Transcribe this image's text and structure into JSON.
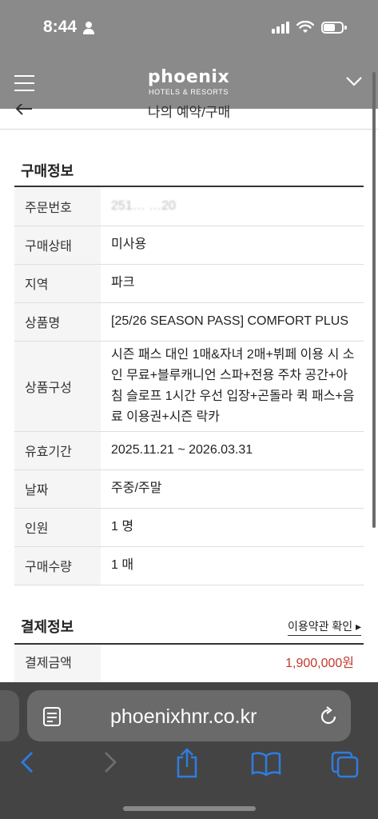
{
  "status_bar": {
    "time": "8:44"
  },
  "header": {
    "brand_logo": "phoenix",
    "brand_sub": "HOTELS & RESORTS"
  },
  "page": {
    "title": "나의 예약/구매"
  },
  "purchase": {
    "section_title": "구매정보",
    "rows": [
      {
        "key": "주문번호",
        "value": "251… …20"
      },
      {
        "key": "구매상태",
        "value": "미사용"
      },
      {
        "key": "지역",
        "value": "파크"
      },
      {
        "key": "상품명",
        "value": "[25/26 SEASON PASS] COMFORT PLUS"
      },
      {
        "key": "상품구성",
        "value": "시즌 패스 대인 1매&자녀 2매+뷔페 이용 시 소인 무료+블루캐니언 스파+전용 주차 공간+아침 슬로프 1시간 우선 입장+곤돌라 퀵 패스+음료 이용권+시즌 락카"
      },
      {
        "key": "유효기간",
        "value": "2025.11.21 ~ 2026.03.31"
      },
      {
        "key": "날짜",
        "value": "주중/주말"
      },
      {
        "key": "인원",
        "value": "1 명"
      },
      {
        "key": "구매수량",
        "value": "1 매"
      }
    ]
  },
  "payment": {
    "section_title": "결제정보",
    "terms_link": "이용약관 확인 ▸",
    "amount_label": "결제금액",
    "amount_value": "1,900,000원"
  },
  "browser": {
    "url": "phoenixhnr.co.kr"
  },
  "colors": {
    "header_gray": "#8a8a8a",
    "amount_red": "#c0392b",
    "chrome_bg": "#444444",
    "ios_blue": "#1a73e8"
  }
}
